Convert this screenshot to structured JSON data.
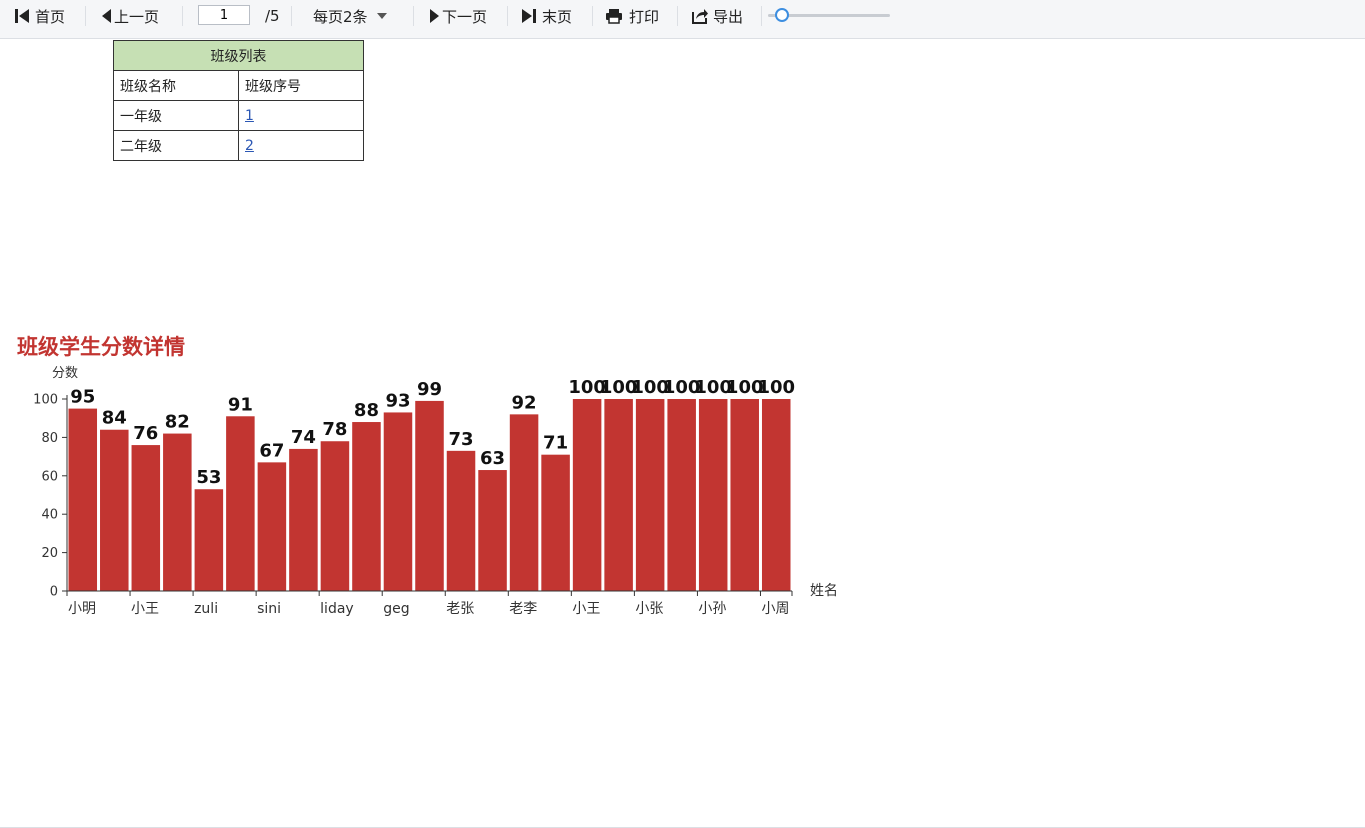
{
  "toolbar": {
    "first_label": "首页",
    "prev_label": "上一页",
    "page_value": "1",
    "page_total": "/5",
    "per_page_label": "每页2条",
    "next_label": "下一页",
    "last_label": "末页",
    "print_label": "打印",
    "export_label": "导出",
    "zoom_level": 0.1
  },
  "class_table": {
    "caption": "班级列表",
    "headers": [
      "班级名称",
      "班级序号"
    ],
    "rows": [
      {
        "name": "一年级",
        "id": "1"
      },
      {
        "name": "二年级",
        "id": "2"
      }
    ]
  },
  "chart_title": "班级学生分数详情",
  "colors": {
    "bar": "#c23531",
    "title": "#c23531",
    "link": "#2b57b4",
    "table_header_bg": "#c6e0b4"
  },
  "chart_data": {
    "type": "bar",
    "title": "班级学生分数详情",
    "xlabel": "姓名",
    "ylabel": "分数",
    "ylim": [
      0,
      100
    ],
    "yticks": [
      0,
      20,
      40,
      60,
      80,
      100
    ],
    "x_tick_labels": [
      "小明",
      "小王",
      "zuli",
      "sini",
      "liday",
      "geg",
      "老张",
      "老李",
      "小王",
      "小张",
      "小孙",
      "小周"
    ],
    "values": [
      95,
      84,
      76,
      82,
      53,
      91,
      67,
      74,
      78,
      88,
      93,
      99,
      73,
      63,
      92,
      71,
      100,
      100,
      100,
      100,
      100,
      100,
      100
    ],
    "grid": false,
    "data_labels": true
  }
}
